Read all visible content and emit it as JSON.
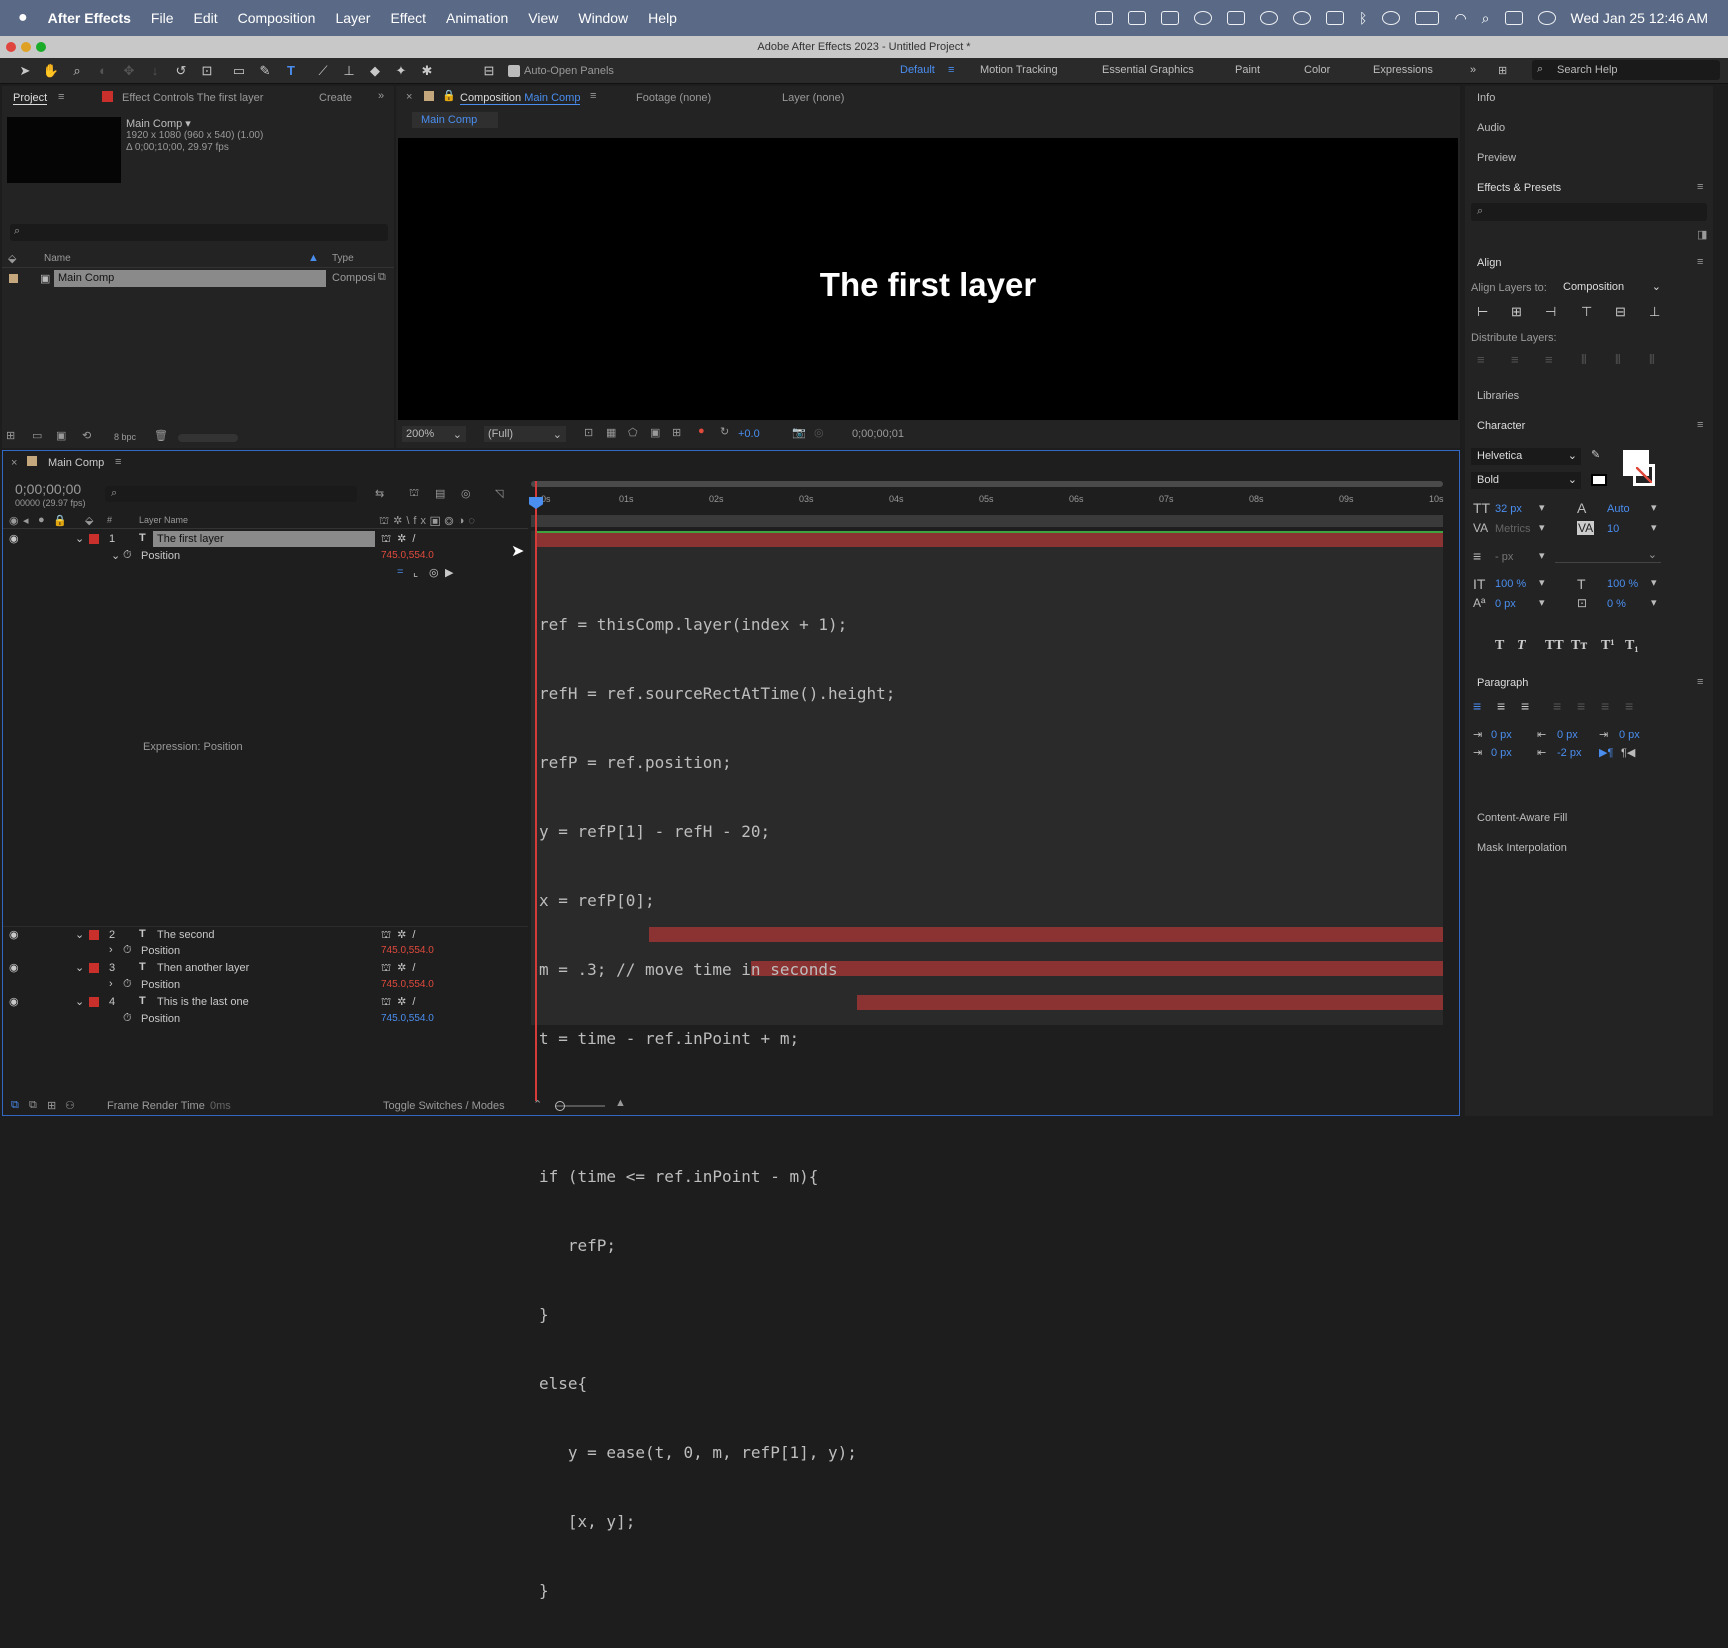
{
  "menubar": {
    "app": "After Effects",
    "items": [
      "File",
      "Edit",
      "Composition",
      "Layer",
      "Effect",
      "Animation",
      "View",
      "Window",
      "Help"
    ],
    "clock": "Wed Jan 25  12:46 AM"
  },
  "window": {
    "title": "Adobe After Effects 2023 - Untitled Project *"
  },
  "toolbar": {
    "auto_open": "Auto-Open Panels",
    "workspaces": [
      "Default",
      "Motion Tracking",
      "Essential Graphics",
      "Paint",
      "Color",
      "Expressions"
    ],
    "search_placeholder": "Search Help"
  },
  "project": {
    "tab": "Project",
    "effect_tab": "Effect Controls The first layer",
    "create": "Create",
    "comp_name": "Main Comp ▾",
    "comp_info1": "1920 x 1080  (960 x 540) (1.00)",
    "comp_info2": "Δ 0;00;10;00, 29.97 fps",
    "col_name": "Name",
    "col_type": "Type",
    "item_name": "Main Comp",
    "item_type": "Composi",
    "bpc": "8 bpc"
  },
  "viewer": {
    "tab_prefix": "Composition",
    "tab_comp": "Main Comp",
    "footage": "Footage (none)",
    "layer": "Layer (none)",
    "comp_btn": "Main Comp",
    "canvas_text": "The first layer",
    "zoom": "200%",
    "res": "(Full)",
    "exposure": "+0.0",
    "timecode": "0;00;00;01"
  },
  "timeline": {
    "tab": "Main Comp",
    "timecode": "0;00;00;00",
    "fps": "00000 (29.97 fps)",
    "col_hash": "#",
    "col_layername": "Layer Name",
    "ticks": [
      "0s",
      "01s",
      "02s",
      "03s",
      "04s",
      "05s",
      "06s",
      "07s",
      "08s",
      "09s",
      "10s"
    ],
    "layers": [
      {
        "num": "1",
        "name": "The first layer",
        "prop": "Position",
        "value": "745.0,554.0"
      },
      {
        "num": "2",
        "name": "The second",
        "prop": "Position",
        "value": "745.0,554.0"
      },
      {
        "num": "3",
        "name": "Then another layer",
        "prop": "Position",
        "value": "745.0,554.0"
      },
      {
        "num": "4",
        "name": "This is the last one",
        "prop": "Position",
        "value": "745.0,554.0"
      }
    ],
    "expr_label": "Expression: Position",
    "code": [
      "ref = thisComp.layer(index + 1);",
      "refH = ref.sourceRectAtTime().height;",
      "refP = ref.position;",
      "y = refP[1] - refH - 20;",
      "x = refP[0];",
      "m = .3; // move time in seconds",
      "t = time - ref.inPoint + m;",
      "",
      "if (time <= ref.inPoint - m){",
      "   refP;",
      "}",
      "else{",
      "   y = ease(t, 0, m, refP[1], y);",
      "   [x, y];",
      "}"
    ],
    "frame_render": "Frame Render Time",
    "frame_ms": "0ms",
    "toggle": "Toggle Switches / Modes"
  },
  "right": {
    "info": "Info",
    "audio": "Audio",
    "preview": "Preview",
    "effects": "Effects & Presets",
    "align": "Align",
    "align_to_label": "Align Layers to:",
    "align_to": "Composition",
    "distribute": "Distribute Layers:",
    "libraries": "Libraries",
    "character": "Character",
    "font": "Helvetica",
    "style": "Bold",
    "size": "32 px",
    "leading": "Auto",
    "kerning": "Metrics",
    "tracking": "10",
    "stroke": "- px",
    "vscale": "100 %",
    "hscale": "100 %",
    "baseline": "0 px",
    "tsume": "0 %",
    "paragraph": "Paragraph",
    "p1": "0 px",
    "p2": "0 px",
    "p3": "0 px",
    "p4": "0 px",
    "p5": "-2 px",
    "caf": "Content-Aware Fill",
    "mask": "Mask Interpolation"
  }
}
